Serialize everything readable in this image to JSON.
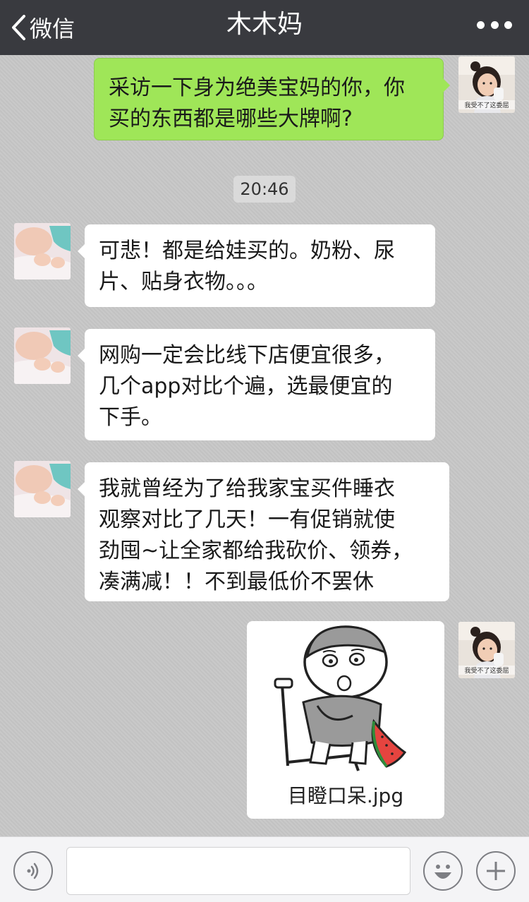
{
  "header": {
    "back_label": "微信",
    "title": "木木妈"
  },
  "chat": {
    "messages": [
      {
        "side": "right",
        "type": "text",
        "avatar": "girl-avatar",
        "text_lines": [
          "采访一下身为绝美宝妈的你，你",
          "买的东西都是哪些大牌啊?"
        ]
      },
      {
        "type": "time",
        "text": "20:46"
      },
      {
        "side": "left",
        "type": "text",
        "avatar": "baby-avatar",
        "text_lines": [
          "可悲！都是给娃买的。奶粉、尿",
          "片、贴身衣物。。。"
        ]
      },
      {
        "side": "left",
        "type": "text",
        "avatar": "baby-avatar",
        "text_lines": [
          "网购一定会比线下店便宜很多，",
          "几个app对比个遍，选最便宜的",
          "下手。"
        ]
      },
      {
        "side": "left",
        "type": "text",
        "avatar": "baby-avatar",
        "text_lines": [
          "我就曾经为了给我家宝买件睡衣",
          "观察对比了几天！一有促销就使",
          "劲囤~让全家都给我砍价、领券，",
          "凑满减！！不到最低价不罢休"
        ]
      },
      {
        "side": "right",
        "type": "image",
        "avatar": "girl-avatar",
        "caption": "目瞪口呆.jpg"
      }
    ],
    "girl_avatar_caption": "我受不了这委屈"
  },
  "input_bar": {
    "input_value": "",
    "icons": [
      "voice-icon",
      "emoji-icon",
      "plus-icon"
    ]
  },
  "colors": {
    "header_bg": "#393a3f",
    "chat_bg": "#c6c6c6",
    "sent_bubble": "#9fe658",
    "received_bubble": "#ffffff"
  }
}
